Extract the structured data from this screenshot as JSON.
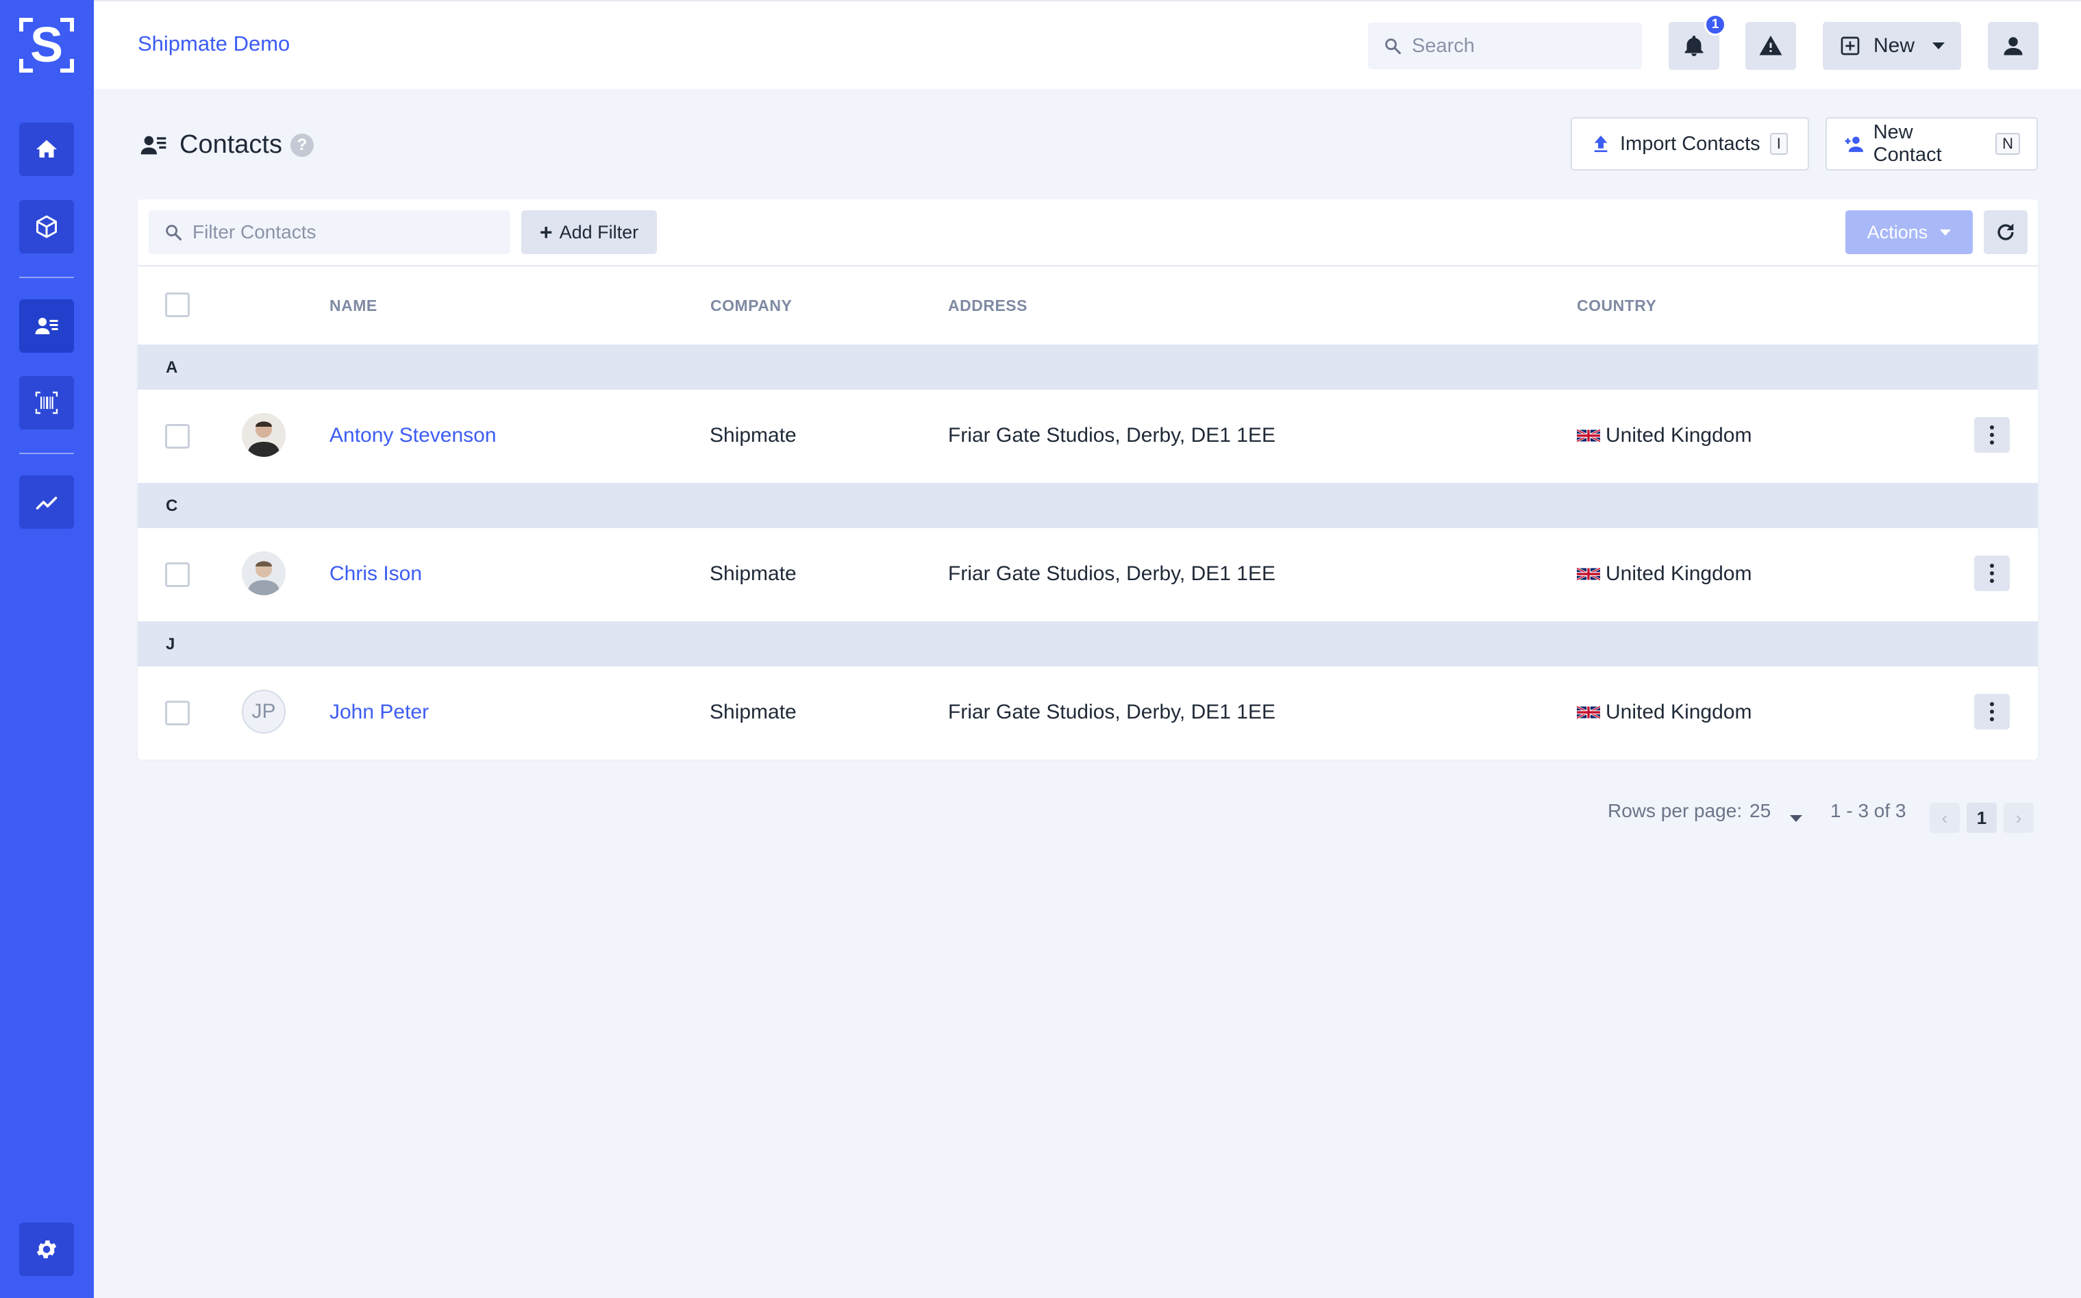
{
  "app": {
    "title": "Shipmate Demo",
    "logo_letter": "S"
  },
  "topbar": {
    "search_placeholder": "Search",
    "notifications_count": "1",
    "new_label": "New"
  },
  "page": {
    "title": "Contacts",
    "help": "?",
    "import_label": "Import Contacts",
    "import_shortcut": "I",
    "new_contact_label": "New Contact",
    "new_contact_shortcut": "N"
  },
  "filters": {
    "placeholder": "Filter Contacts",
    "add_filter_label": "Add Filter",
    "actions_label": "Actions"
  },
  "table": {
    "columns": [
      "NAME",
      "COMPANY",
      "ADDRESS",
      "COUNTRY"
    ],
    "groups": [
      {
        "letter": "A",
        "rows": [
          {
            "name": "Antony Stevenson",
            "company": "Shipmate",
            "address": "Friar Gate Studios, Derby, DE1 1EE",
            "country": "United Kingdom",
            "avatar": "photo"
          }
        ]
      },
      {
        "letter": "C",
        "rows": [
          {
            "name": "Chris Ison",
            "company": "Shipmate",
            "address": "Friar Gate Studios, Derby, DE1 1EE",
            "country": "United Kingdom",
            "avatar": "photo"
          }
        ]
      },
      {
        "letter": "J",
        "rows": [
          {
            "name": "John Peter",
            "company": "Shipmate",
            "address": "Friar Gate Studios, Derby, DE1 1EE",
            "country": "United Kingdom",
            "avatar": "initials",
            "initials": "JP"
          }
        ]
      }
    ]
  },
  "pagination": {
    "rows_per_page_label": "Rows per page:",
    "rows_per_page": "25",
    "range": "1 - 3 of 3",
    "current_page": "1"
  },
  "sidebar": {
    "items": [
      "home-icon",
      "package-icon",
      "contacts-icon",
      "barcode-icon",
      "analytics-icon",
      "settings-icon"
    ]
  },
  "colors": {
    "accent": "#3c5cf4",
    "sidebar": "#3c5cf4",
    "background": "#f1f4fb"
  }
}
